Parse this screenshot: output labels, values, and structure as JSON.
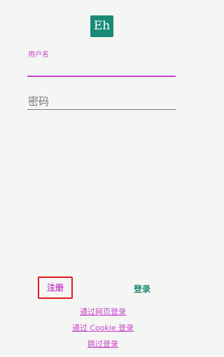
{
  "logo": {
    "text": "Eh",
    "color": "#1a8a78"
  },
  "username_field": {
    "label": "用户名",
    "value": ""
  },
  "password_field": {
    "placeholder": "密码"
  },
  "actions": {
    "register": "注册",
    "login": "登录",
    "web_login": "通过网页登录",
    "cookie_login": "通过 Cookie 登录",
    "skip_login": "跳过登录"
  },
  "colors": {
    "accent": "#cc44cc",
    "brand": "#1a8a78",
    "highlight_box": "#e01b1b"
  }
}
